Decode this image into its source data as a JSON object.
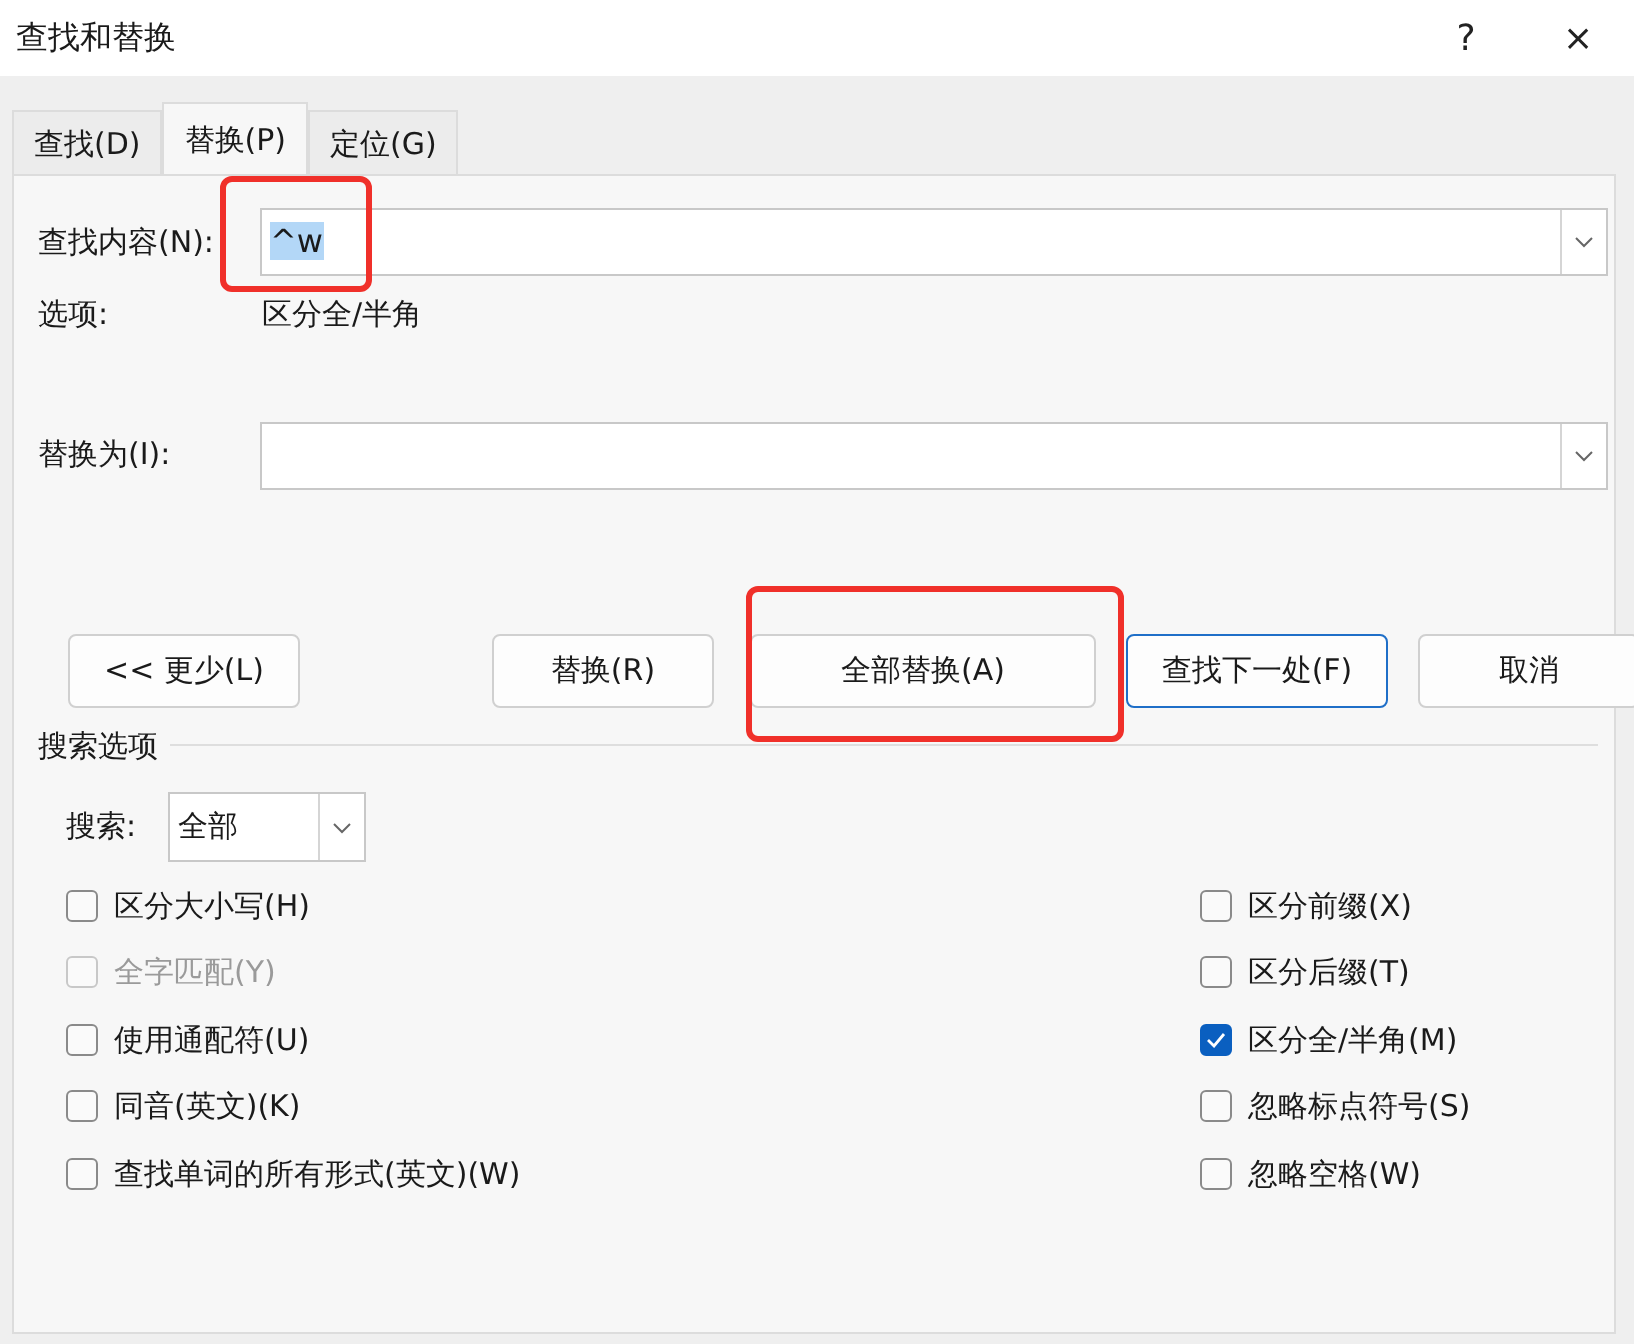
{
  "window": {
    "title": "查找和替换",
    "help": "?",
    "close": "×"
  },
  "tabs": [
    {
      "label": "查找(D)",
      "selected": false
    },
    {
      "label": "替换(P)",
      "selected": true
    },
    {
      "label": "定位(G)",
      "selected": false
    }
  ],
  "find": {
    "label": "查找内容(N):",
    "value": "^w",
    "value_selected": true,
    "highlighted": true
  },
  "options": {
    "label": "选项:",
    "value": "区分全/半角"
  },
  "replace": {
    "label": "替换为(I):"
  },
  "buttons": [
    {
      "label": "<< 更少(L)",
      "default": false,
      "highlighted": false
    },
    {
      "label": "替换(R)",
      "default": false,
      "highlighted": false
    },
    {
      "label": "全部替换(A)",
      "default": false,
      "highlighted": true
    },
    {
      "label": "查找下一处(F)",
      "default": true,
      "highlighted": false
    },
    {
      "label": "取消",
      "default": false,
      "highlighted": false
    }
  ],
  "search_options": {
    "title": "搜索选项",
    "search_label": "搜索:",
    "search_value": "全部",
    "left": [
      {
        "label": "区分大小写(H)",
        "checked": false,
        "disabled": false
      },
      {
        "label": "全字匹配(Y)",
        "checked": false,
        "disabled": true
      },
      {
        "label": "使用通配符(U)",
        "checked": false,
        "disabled": false
      },
      {
        "label": "同音(英文)(K)",
        "checked": false,
        "disabled": false
      },
      {
        "label": "查找单词的所有形式(英文)(W)",
        "checked": false,
        "disabled": false
      }
    ],
    "right": [
      {
        "label": "区分前缀(X)",
        "checked": false,
        "disabled": false
      },
      {
        "label": "区分后缀(T)",
        "checked": false,
        "disabled": false
      },
      {
        "label": "区分全/半角(M)",
        "checked": true,
        "disabled": false
      },
      {
        "label": "忽略标点符号(S)",
        "checked": false,
        "disabled": false
      },
      {
        "label": "忽略空格(W)",
        "checked": false,
        "disabled": false
      }
    ]
  }
}
